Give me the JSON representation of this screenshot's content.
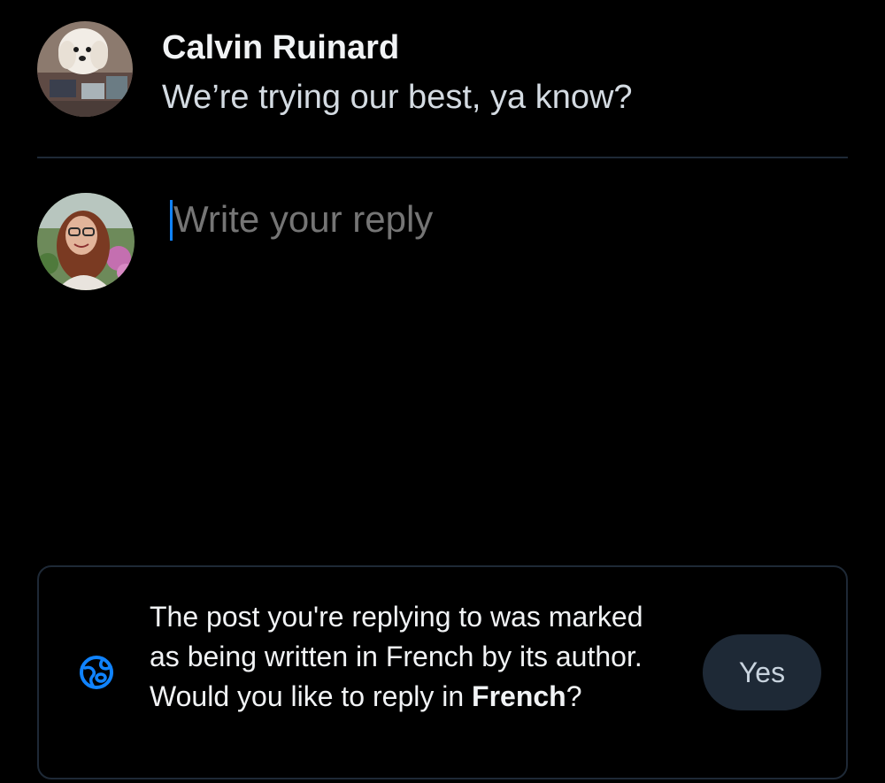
{
  "post": {
    "author_name": "Calvin Ruinard",
    "text": "We’re trying our best, ya know?"
  },
  "composer": {
    "placeholder": "Write your reply"
  },
  "language_hint": {
    "icon": "globe-icon",
    "text_before": "The post you're replying to was marked as being written in French by its author. Would you like to reply in ",
    "language": "French",
    "text_after": "?",
    "yes_label": "Yes"
  },
  "colors": {
    "background": "#000000",
    "divider": "#1e2936",
    "accent": "#1083fe",
    "placeholder": "#93a5b7",
    "button_bg": "#1e2936"
  }
}
